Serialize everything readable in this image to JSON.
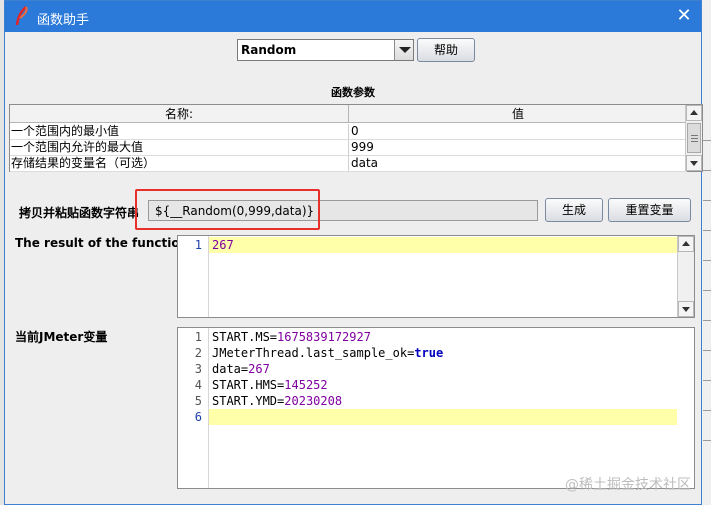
{
  "window": {
    "title": "函数助手"
  },
  "function_select": {
    "value": "Random",
    "help_label": "帮助"
  },
  "params": {
    "section_title": "函数参数",
    "columns": [
      "名称:",
      "值"
    ],
    "rows": [
      {
        "name": "一个范围内的最小值",
        "value": "0"
      },
      {
        "name": "一个范围内允许的最大值",
        "value": "999"
      },
      {
        "name": "存储结果的变量名（可选）",
        "value": "data"
      }
    ]
  },
  "copy_paste": {
    "label": "拷贝并粘贴函数字符串",
    "value": "${__Random(0,999,data)}",
    "generate_label": "生成",
    "reset_label": "重置变量"
  },
  "result": {
    "label": "The result of the function is",
    "lines": [
      {
        "num": "1",
        "text": "267"
      }
    ]
  },
  "variables": {
    "label": "当前JMeter变量",
    "lines": [
      {
        "num": "1",
        "key": "START.MS",
        "value": "1675839172927"
      },
      {
        "num": "2",
        "key": "JMeterThread.last_sample_ok",
        "value": "true"
      },
      {
        "num": "3",
        "key": "data",
        "value": "267"
      },
      {
        "num": "4",
        "key": "START.HMS",
        "value": "145252"
      },
      {
        "num": "5",
        "key": "START.YMD",
        "value": "20230208"
      },
      {
        "num": "6",
        "key": "",
        "value": ""
      }
    ]
  },
  "watermark": "@稀土掘金技术社区",
  "colors": {
    "titlebar": "#2b79d8",
    "highlight_box": "#e8302b",
    "current_line": "#ffffaa",
    "value_purple": "#7f00a0"
  },
  "icons": {
    "app": "jmeter-feather-icon",
    "close": "close-icon"
  }
}
